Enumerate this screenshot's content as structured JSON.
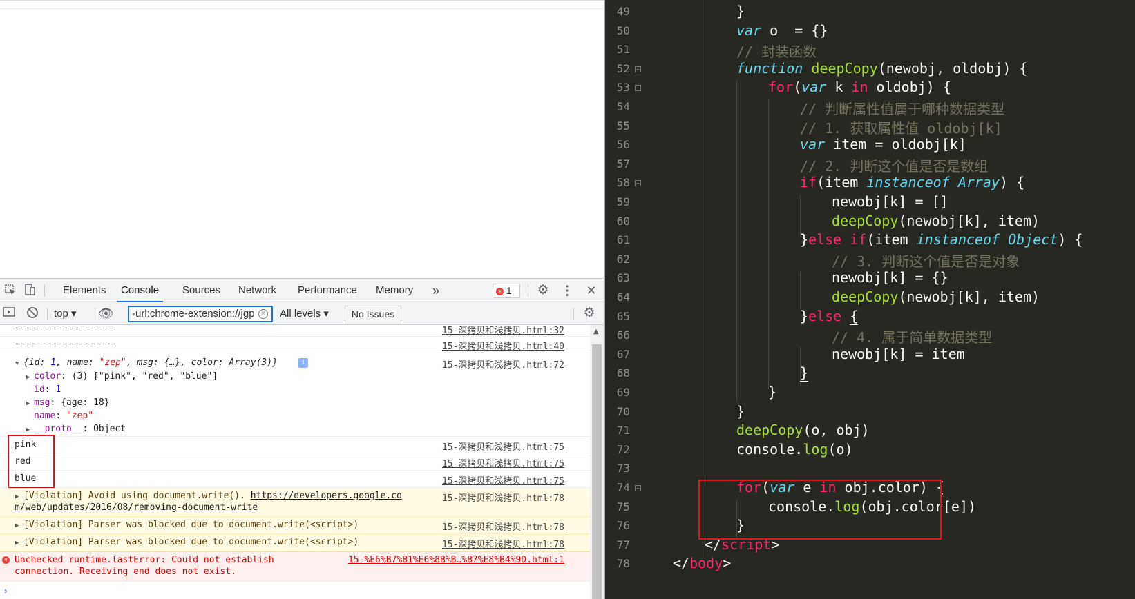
{
  "devtools": {
    "tabs": [
      "Elements",
      "Console",
      "Sources",
      "Network",
      "Performance",
      "Memory"
    ],
    "active_tab": "Console",
    "more_tabs": "»",
    "error_count": "1",
    "toolbar": {
      "context": "top",
      "filter_value": "-url:chrome-extension://jgp",
      "levels": "All levels",
      "issues": "No Issues"
    }
  },
  "console": {
    "rows": [
      {
        "text": "-------------------",
        "source": "15-深拷贝和浅拷贝.html:32"
      },
      {
        "text": "-------------------",
        "source": "15-深拷贝和浅拷贝.html:40"
      },
      {
        "text": "{id: 1, name: \"zep\", msg: {…}, color: Array(3)}",
        "source": "15-深拷贝和浅拷贝.html:72"
      },
      {
        "text": "pink",
        "source": "15-深拷贝和浅拷贝.html:75"
      },
      {
        "text": "red",
        "source": "15-深拷贝和浅拷贝.html:75"
      },
      {
        "text": "blue",
        "source": "15-深拷贝和浅拷贝.html:75"
      },
      {
        "text": "[Violation] Avoid using document.write(). ",
        "link": "https://developers.google.co",
        "link2": "m/web/updates/2016/08/removing-document-write",
        "source": "15-深拷贝和浅拷贝.html:78"
      },
      {
        "text": "[Violation] Parser was blocked due to document.write(<script>)",
        "source": "15-深拷贝和浅拷贝.html:78"
      },
      {
        "text": "[Violation] Parser was blocked due to document.write(<script>)",
        "source": "15-深拷贝和浅拷贝.html:78"
      },
      {
        "text": "Unchecked runtime.lastError: Could not establish",
        "text2": "connection. Receiving end does not exist.",
        "source": "15-%E6%B7%B1%E6%8B%B…%B7%E8%B4%9D.html:1"
      }
    ],
    "object_props": {
      "color_key": "color",
      "color_val": "(3) [\"pink\", \"red\", \"blue\"]",
      "id_key": "id",
      "id_val": "1",
      "msg_key": "msg",
      "msg_val": "{age: 18}",
      "name_key": "name",
      "name_val": "\"zep\"",
      "proto_key": "__proto__",
      "proto_val": "Object"
    }
  },
  "editor": {
    "line_numbers": [
      "49",
      "50",
      "51",
      "52",
      "53",
      "54",
      "55",
      "56",
      "57",
      "58",
      "59",
      "60",
      "61",
      "62",
      "63",
      "64",
      "65",
      "66",
      "67",
      "68",
      "69",
      "70",
      "71",
      "72",
      "73",
      "74",
      "75",
      "76",
      "77",
      "78"
    ],
    "comments": {
      "c51": "// 封装函数",
      "c54": "// 判断属性值属于哪种数据类型",
      "c55": "// 1. 获取属性值 oldobj[k]",
      "c57": "// 2. 判断这个值是否是数组",
      "c62": "// 3. 判断这个值是否是对象",
      "c66": "// 4. 属于简单数据类型"
    }
  },
  "colors": {
    "editor_bg": "#272822",
    "highlight_box": "#e0141e",
    "devtools_accent": "#1a73e8"
  }
}
